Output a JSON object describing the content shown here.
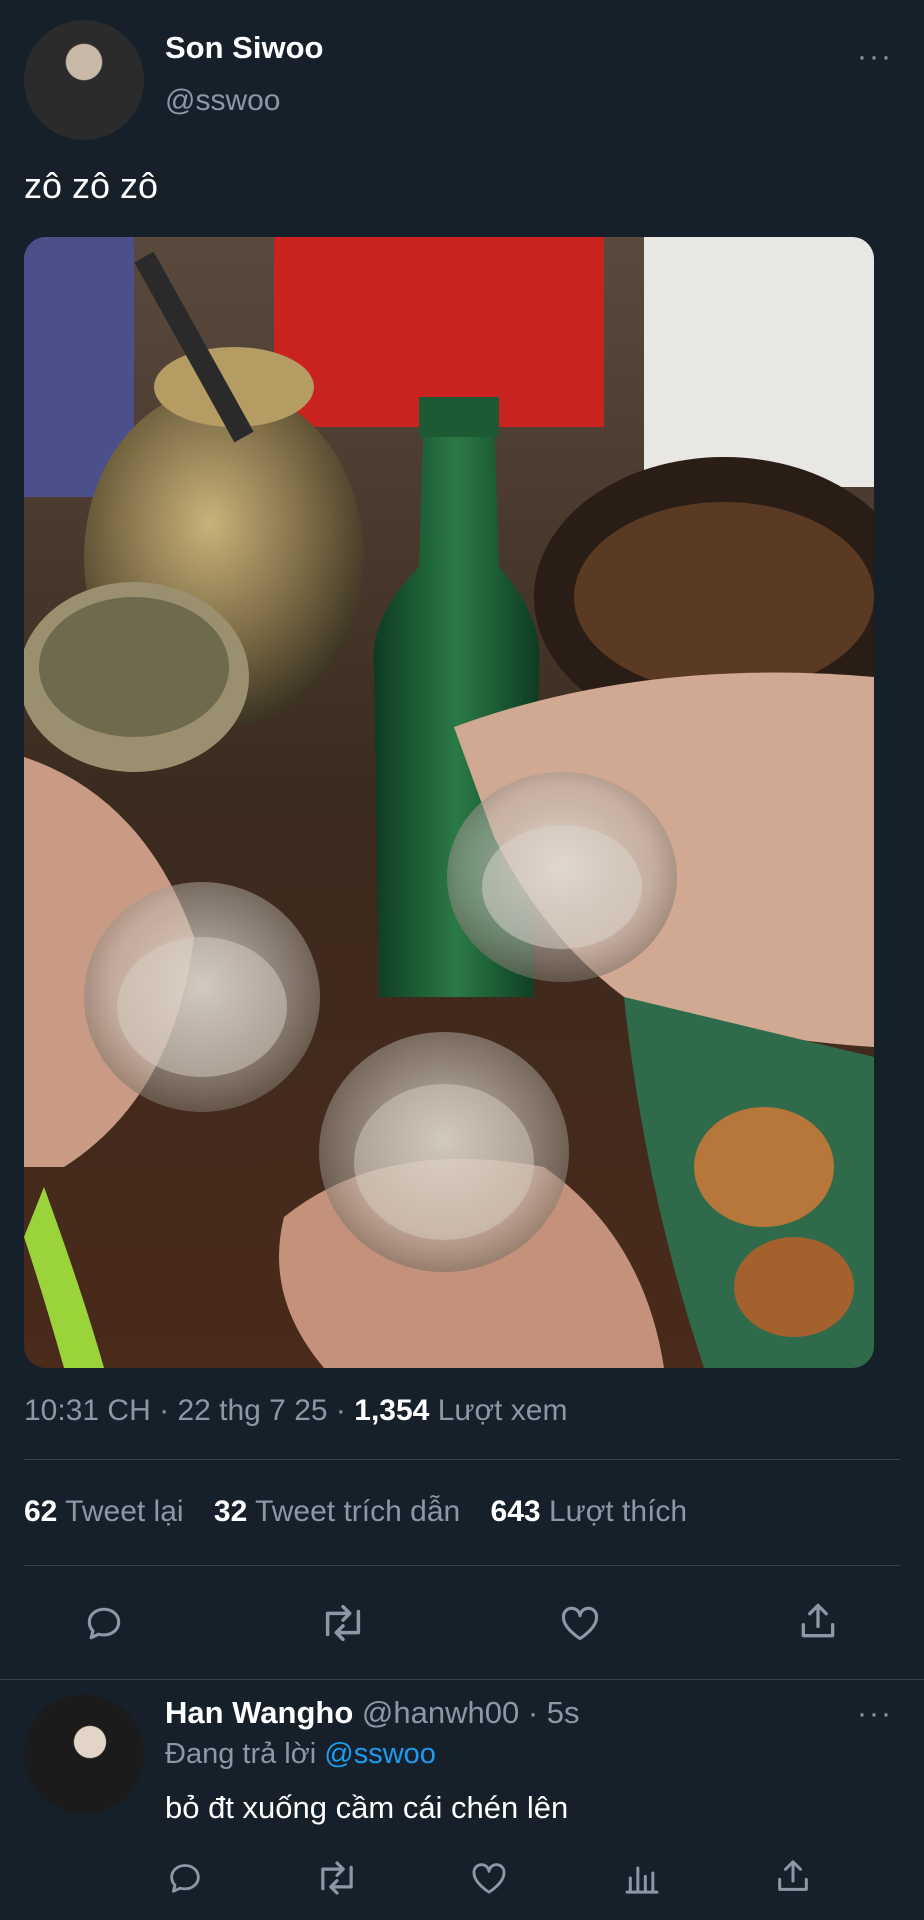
{
  "tweet": {
    "author_name": "Son Siwoo",
    "author_handle": "@sswoo",
    "text": "zô zô zô",
    "more": "···",
    "meta": {
      "time": "10:31 CH",
      "sep1": "·",
      "date": "22 thg 7 25",
      "sep2": "·",
      "views_count": "1,354",
      "views_label": "Lượt xem"
    },
    "stats": {
      "retweets_count": "62",
      "retweets_label": "Tweet lại",
      "quotes_count": "32",
      "quotes_label": "Tweet trích dẫn",
      "likes_count": "643",
      "likes_label": "Lượt thích"
    },
    "actions": [
      "reply-icon",
      "retweet-icon",
      "like-icon",
      "share-icon"
    ]
  },
  "reply": {
    "author_name": "Han Wangho",
    "author_handle": "@hanwh00",
    "sep": "·",
    "time": "5s",
    "replying_prefix": "Đang trả lời",
    "replying_to": "@sswoo",
    "text": "bỏ đt xuống cầm cái chén lên",
    "more": "···",
    "actions": [
      "reply-icon",
      "retweet-icon",
      "like-icon",
      "analytics-icon",
      "share-icon"
    ]
  },
  "colors": {
    "background": "#15202b",
    "muted": "#8b98a5",
    "link": "#1d9bf0",
    "divider": "#38444d"
  }
}
